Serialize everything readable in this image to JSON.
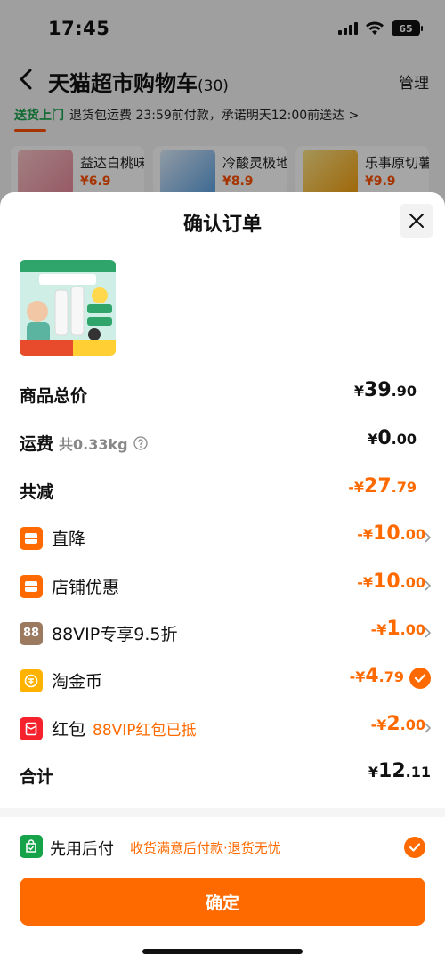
{
  "status_bar": {
    "time": "17:45",
    "battery": "65"
  },
  "cart": {
    "title": "天猫超市购物车",
    "count": "(30)",
    "manage_label": "管理",
    "delivery_tag": "送货上门",
    "delivery_text": "退货包运费 23:59前付款，承诺明天12:00前送达",
    "delivery_chevron": ">",
    "recommendations": [
      {
        "name": "益达白桃味",
        "price": "¥6.9"
      },
      {
        "name": "冷酸灵极地",
        "price": "¥8.9"
      },
      {
        "name": "乐事原切薯",
        "price": "¥9.9"
      }
    ]
  },
  "order_sheet": {
    "title": "确认订单",
    "close_icon": "close-icon",
    "product_image_alt": "product-thumbnail",
    "rows": {
      "subtotal": {
        "label": "商品总价",
        "yen": "¥",
        "integer": "39",
        "cents": ".90"
      },
      "shipping": {
        "label": "运费",
        "sub": "共0.33kg",
        "yen": "¥",
        "integer": "0",
        "cents": ".00"
      },
      "total_discount": {
        "label": "共减",
        "yen": "-¥",
        "integer": "27",
        "cents": ".79"
      },
      "direct_drop": {
        "label": "直降",
        "yen": "-¥",
        "integer": "10",
        "cents": ".00"
      },
      "store_coupon": {
        "label": "店铺优惠",
        "yen": "-¥",
        "integer": "10",
        "cents": ".00"
      },
      "vip": {
        "badge": "88",
        "label": "88VIP专享9.5折",
        "yen": "-¥",
        "integer": "1",
        "cents": ".00"
      },
      "coins": {
        "label": "淘金币",
        "yen": "-¥",
        "integer": "4",
        "cents": ".79"
      },
      "red_packet": {
        "label": "红包",
        "note": "88VIP红包已抵",
        "yen": "-¥",
        "integer": "2",
        "cents": ".00"
      },
      "total": {
        "label": "合计",
        "yen": "¥",
        "integer": "12",
        "cents": ".11"
      }
    },
    "pay_later": {
      "label": "先用后付",
      "note": "收货满意后付款·退货无忧",
      "checked": true
    },
    "confirm_label": "确定"
  },
  "colors": {
    "accent": "#ff6a00",
    "green": "#16a34a",
    "vip": "#9b7a60"
  }
}
